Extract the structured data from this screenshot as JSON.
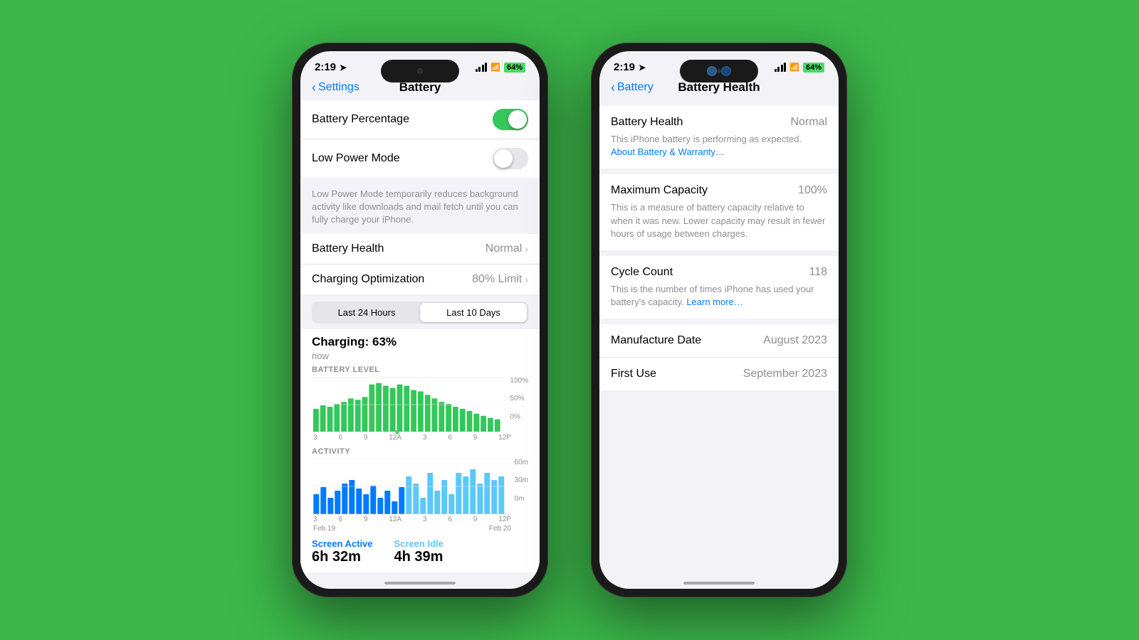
{
  "background_color": "#3cb84a",
  "phone1": {
    "status": {
      "time": "2:19",
      "battery_pct": "64%"
    },
    "nav": {
      "back_label": "Settings",
      "title": "Battery"
    },
    "rows": [
      {
        "label": "Battery Percentage",
        "toggle": "on"
      },
      {
        "label": "Low Power Mode",
        "toggle": "off"
      }
    ],
    "low_power_desc": "Low Power Mode temporarily reduces background activity like downloads and mail fetch until you can fully charge your iPhone.",
    "battery_health_row": {
      "label": "Battery Health",
      "value": "Normal"
    },
    "charging_optimization_row": {
      "label": "Charging Optimization",
      "value": "80% Limit"
    },
    "tabs": {
      "tab1": "Last 24 Hours",
      "tab2": "Last 10 Days",
      "active": "tab2"
    },
    "charging": {
      "label": "Charging: 63%",
      "sub": "now"
    },
    "chart": {
      "battery_level_label": "BATTERY LEVEL",
      "y_labels": [
        "100%",
        "50%",
        "0%"
      ],
      "x_labels": [
        "3",
        "6",
        "9",
        "12A",
        "3",
        "6",
        "9",
        "12P"
      ],
      "activity_label": "ACTIVITY",
      "activity_y_labels": [
        "60m",
        "30m",
        "0m"
      ],
      "date_labels": [
        "Feb 19",
        "Feb 20"
      ]
    },
    "screen_time": {
      "active_label": "Screen Active",
      "active_value": "6h 32m",
      "idle_label": "Screen Idle",
      "idle_value": "4h 39m"
    }
  },
  "phone2": {
    "status": {
      "time": "2:19",
      "battery_pct": "64%"
    },
    "nav": {
      "back_label": "Battery",
      "title": "Battery Health"
    },
    "battery_health": {
      "label": "Battery Health",
      "value": "Normal",
      "desc_normal": "This iPhone battery is performing as expected.",
      "desc_link": "About Battery & Warranty…"
    },
    "maximum_capacity": {
      "label": "Maximum Capacity",
      "value": "100%",
      "desc": "This is a measure of battery capacity relative to when it was new. Lower capacity may result in fewer hours of usage between charges."
    },
    "cycle_count": {
      "label": "Cycle Count",
      "value": "118",
      "desc_normal": "This is the number of times iPhone has used your battery's capacity.",
      "desc_link": "Learn more…"
    },
    "manufacture_date": {
      "label": "Manufacture Date",
      "value": "August 2023"
    },
    "first_use": {
      "label": "First Use",
      "value": "September 2023"
    }
  }
}
